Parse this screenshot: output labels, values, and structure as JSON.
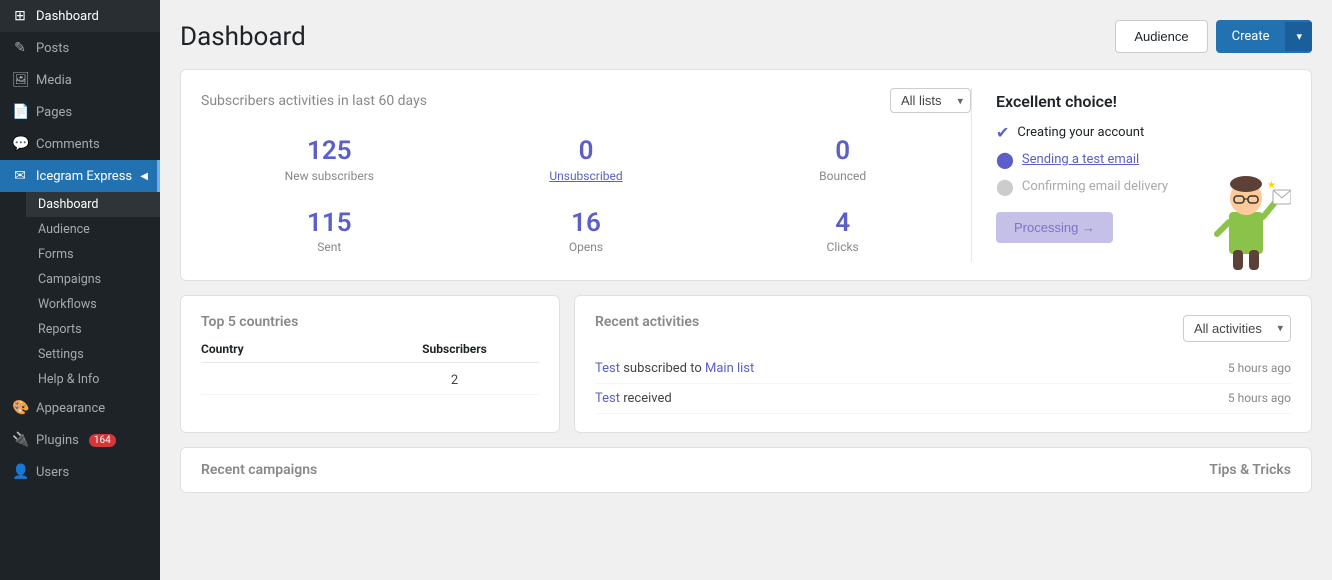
{
  "sidebar": {
    "items": [
      {
        "id": "dashboard-top",
        "label": "Dashboard",
        "icon": "⊞"
      },
      {
        "id": "posts",
        "label": "Posts",
        "icon": "✎"
      },
      {
        "id": "media",
        "label": "Media",
        "icon": "🖼"
      },
      {
        "id": "pages",
        "label": "Pages",
        "icon": "📄"
      },
      {
        "id": "comments",
        "label": "Comments",
        "icon": "💬"
      },
      {
        "id": "icegram",
        "label": "Icegram Express",
        "icon": "✉"
      },
      {
        "id": "appearance",
        "label": "Appearance",
        "icon": "🎨"
      },
      {
        "id": "plugins",
        "label": "Plugins",
        "icon": "🔌"
      },
      {
        "id": "users",
        "label": "Users",
        "icon": "👤"
      }
    ],
    "submenu": [
      {
        "id": "dashboard",
        "label": "Dashboard"
      },
      {
        "id": "audience",
        "label": "Audience"
      },
      {
        "id": "forms",
        "label": "Forms"
      },
      {
        "id": "campaigns",
        "label": "Campaigns"
      },
      {
        "id": "workflows",
        "label": "Workflows"
      },
      {
        "id": "reports",
        "label": "Reports"
      },
      {
        "id": "settings",
        "label": "Settings"
      },
      {
        "id": "help",
        "label": "Help & Info"
      }
    ],
    "plugins_badge": "164"
  },
  "header": {
    "title": "Dashboard",
    "audience_btn": "Audience",
    "create_btn": "Create"
  },
  "stats": {
    "section_title": "Subscribers activities in last 60 days",
    "dropdown_label": "All lists",
    "metrics": [
      {
        "id": "new_subscribers",
        "value": "125",
        "label": "New subscribers"
      },
      {
        "id": "unsubscribed",
        "value": "0",
        "label": "Unsubscribed"
      },
      {
        "id": "bounced",
        "value": "0",
        "label": "Bounced"
      },
      {
        "id": "sent",
        "value": "115",
        "label": "Sent"
      },
      {
        "id": "opens",
        "value": "16",
        "label": "Opens"
      },
      {
        "id": "clicks",
        "value": "4",
        "label": "Clicks"
      }
    ]
  },
  "checklist": {
    "title": "Excellent choice!",
    "items": [
      {
        "id": "create_account",
        "label": "Creating your account",
        "status": "done"
      },
      {
        "id": "test_email",
        "label": "Sending a test email",
        "status": "progress"
      },
      {
        "id": "confirm_delivery",
        "label": "Confirming email delivery",
        "status": "pending"
      }
    ],
    "processing_btn": "Processing →"
  },
  "countries": {
    "section_title": "Top 5 countries",
    "col_country": "Country",
    "col_subscribers": "Subscribers",
    "rows": [
      {
        "country": "",
        "subscribers": "2"
      }
    ]
  },
  "activities": {
    "section_title": "Recent activities",
    "dropdown_label": "All activities",
    "rows": [
      {
        "text_before": "Test",
        "link1": "Test",
        "text_mid": "subscribed to",
        "link2": "Main list",
        "text_after": "",
        "time": "5 hours ago"
      },
      {
        "text_before": "",
        "link1": "Test",
        "text_mid": "received",
        "link2": "",
        "text_after": "",
        "time": "5 hours ago"
      }
    ]
  },
  "recent_campaigns": {
    "section_title": "Recent campaigns",
    "tips_title": "Tips & Tricks"
  }
}
